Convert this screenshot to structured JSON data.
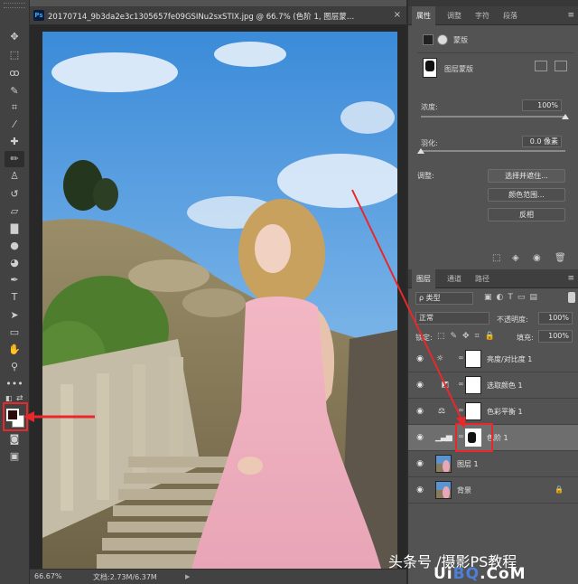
{
  "document": {
    "app_badge": "Ps",
    "tab_title": "20170714_9b3da2e3c1305657fe09GSINu2sxSTIX.jpg @ 66.7% (色阶 1, 图层蒙…",
    "close_glyph": "×",
    "zoom": "66.67%",
    "doc_size": "文档:2.73M/6.37M"
  },
  "properties_panel": {
    "tabs": [
      "属性",
      "调整",
      "字符",
      "段落"
    ],
    "title": "蒙版",
    "mask_label": "图层蒙版",
    "density_label": "浓度:",
    "density_value": "100%",
    "density_fraction": 1.0,
    "feather_label": "羽化:",
    "feather_value": "0.0 像素",
    "feather_fraction": 0.0,
    "adjust_label": "调整:",
    "buttons": [
      "选择并遮住...",
      "颜色范围...",
      "反相"
    ]
  },
  "layers_panel": {
    "tabs": [
      "图层",
      "通道",
      "路径"
    ],
    "filter_label": "ρ 类型",
    "blend_mode": "正常",
    "opacity_label": "不透明度:",
    "opacity_value": "100%",
    "lock_label": "锁定:",
    "fill_label": "填充:",
    "fill_value": "100%",
    "layers": [
      {
        "name": "亮度/对比度 1",
        "type": "adjustment",
        "icon": "sun-icon"
      },
      {
        "name": "选取颜色 1",
        "type": "adjustment",
        "icon": "selective-color-icon"
      },
      {
        "name": "色彩平衡 1",
        "type": "adjustment",
        "icon": "color-balance-icon"
      },
      {
        "name": "色阶 1",
        "type": "adjustment",
        "icon": "levels-icon",
        "selected": true
      },
      {
        "name": "图层 1",
        "type": "image"
      },
      {
        "name": "背景",
        "type": "image",
        "locked": true
      }
    ]
  },
  "watermark": {
    "line1": "头条号 /摄影PS教程",
    "line2_a": "Ui",
    "line2_b": "BQ",
    "line2_c": ".CoM"
  },
  "colors": {
    "accent_red": "#e8282b",
    "foreground_color": "#2b0a0a",
    "background_color": "#ffffff"
  }
}
